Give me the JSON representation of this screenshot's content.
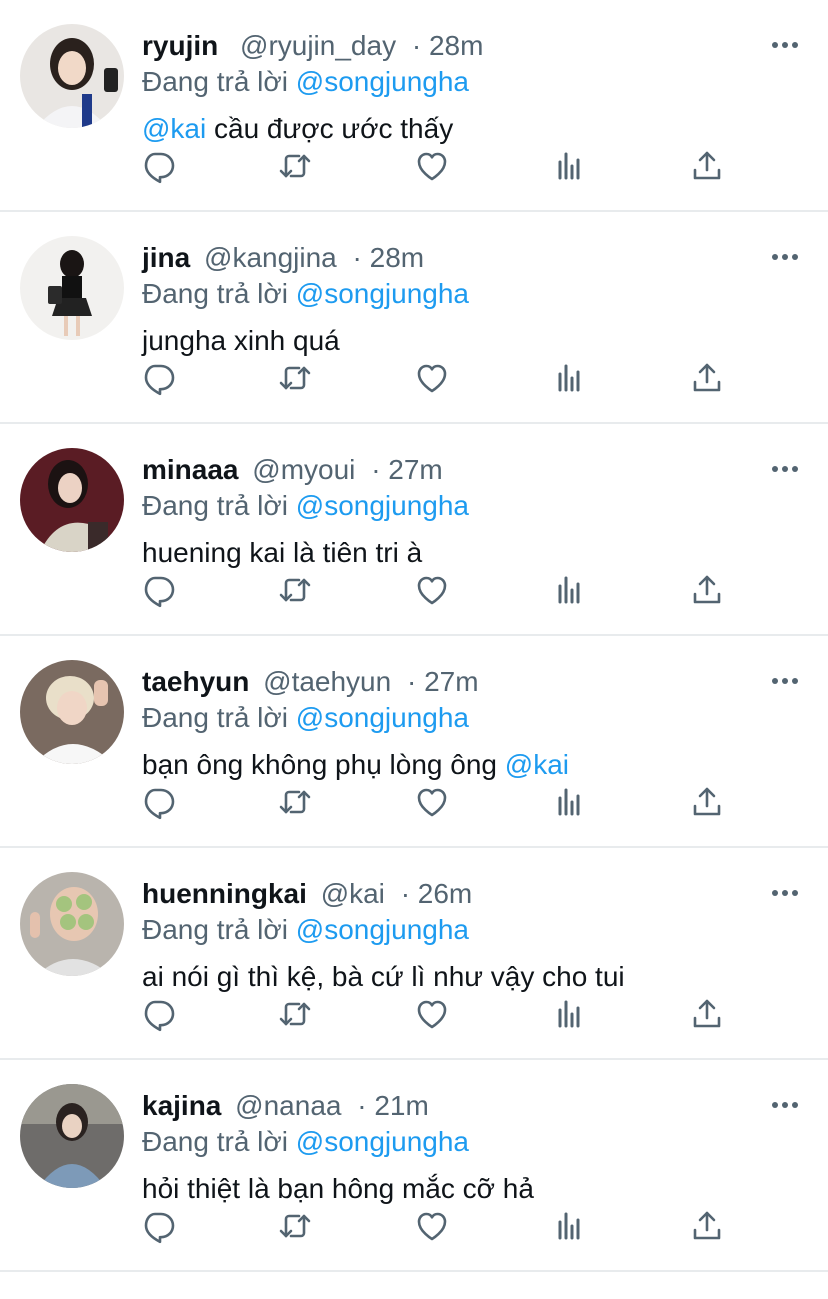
{
  "colors": {
    "accent": "#1d9bf0",
    "muted": "#536471",
    "text": "#0f1419",
    "divider": "#e8ebed"
  },
  "icons": [
    "more-icon",
    "reply-icon",
    "retweet-icon",
    "like-icon",
    "views-icon",
    "share-icon"
  ],
  "replies": [
    {
      "name": "ryujin",
      "handle": "@ryujin_day",
      "time": "· 28m",
      "replying_prefix": "Đang trả lời",
      "replying_to": "@songjungha",
      "mention": "@kai",
      "text": " cầu được ước thấy",
      "text_after": ""
    },
    {
      "name": "jina",
      "handle": "@kangjina",
      "time": "· 28m",
      "replying_prefix": "Đang trả lời",
      "replying_to": "@songjungha",
      "mention": "",
      "text": "jungha xinh quá",
      "text_after": ""
    },
    {
      "name": "minaaa",
      "handle": "@myoui",
      "time": "· 27m",
      "replying_prefix": "Đang trả lời",
      "replying_to": "@songjungha",
      "mention": "",
      "text": "huening kai là tiên tri à",
      "text_after": ""
    },
    {
      "name": "taehyun",
      "handle": "@taehyun",
      "time": "· 27m",
      "replying_prefix": "Đang trả lời",
      "replying_to": "@songjungha",
      "mention": "",
      "text": "bạn ông không phụ lòng ông ",
      "text_after": "@kai"
    },
    {
      "name": "huenningkai",
      "handle": "@kai",
      "time": "· 26m",
      "replying_prefix": "Đang trả lời",
      "replying_to": "@songjungha",
      "mention": "",
      "text": "ai nói gì thì kệ, bà cứ lì như vậy cho tui",
      "text_after": ""
    },
    {
      "name": "kajina",
      "handle": "@nanaa",
      "time": "· 21m",
      "replying_prefix": "Đang trả lời",
      "replying_to": "@songjungha",
      "mention": "",
      "text": "hỏi thiệt là bạn hông mắc cỡ hả",
      "text_after": ""
    }
  ]
}
